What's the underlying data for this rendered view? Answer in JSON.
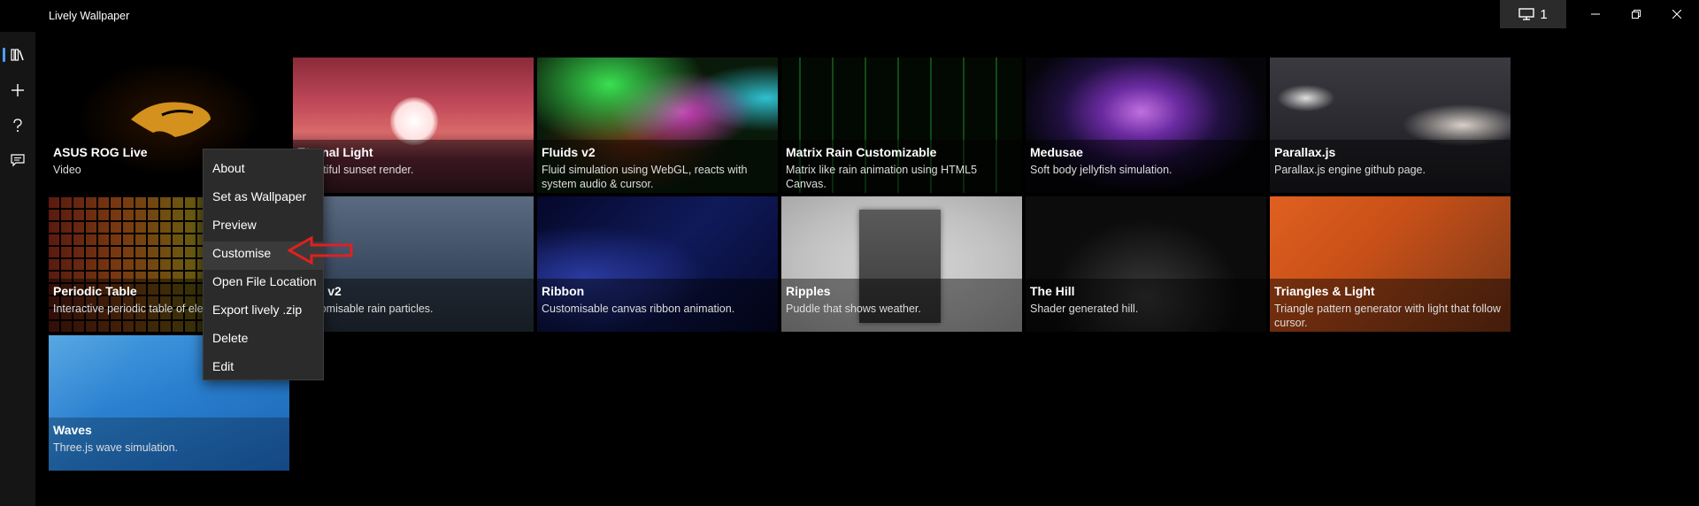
{
  "app": {
    "title": "Lively Wallpaper"
  },
  "titlebar": {
    "monitor_count": "1"
  },
  "nav": {
    "items": [
      {
        "icon": "library-icon",
        "label": "Library"
      },
      {
        "icon": "add-icon",
        "label": "Add"
      },
      {
        "icon": "help-icon",
        "label": "Help"
      },
      {
        "icon": "feedback-icon",
        "label": "Feedback"
      }
    ]
  },
  "tiles": [
    {
      "title": "ASUS ROG Live",
      "desc": "Video"
    },
    {
      "title": "Eternal Light",
      "desc": "Beautiful sunset render."
    },
    {
      "title": "Fluids v2",
      "desc": "Fluid simulation using WebGL, reacts with system audio & cursor."
    },
    {
      "title": "Matrix Rain Customizable",
      "desc": "Matrix like rain animation using HTML5 Canvas."
    },
    {
      "title": "Medusae",
      "desc": "Soft body jellyfish simulation."
    },
    {
      "title": "Parallax.js",
      "desc": "Parallax.js engine github page."
    },
    {
      "title": "Periodic Table",
      "desc": "Interactive periodic table of elements."
    },
    {
      "title": "Rain v2",
      "desc": "Customisable rain particles."
    },
    {
      "title": "Ribbon",
      "desc": "Customisable canvas ribbon animation."
    },
    {
      "title": "Ripples",
      "desc": "Puddle that shows weather."
    },
    {
      "title": "The Hill",
      "desc": "Shader generated hill."
    },
    {
      "title": "Triangles & Light",
      "desc": "Triangle pattern generator with light that follow cursor."
    },
    {
      "title": "Waves",
      "desc": "Three.js wave simulation."
    }
  ],
  "context_menu": {
    "items": [
      "About",
      "Set as Wallpaper",
      "Preview",
      "Customise",
      "Open File Location",
      "Export lively .zip",
      "Delete",
      "Edit"
    ],
    "highlighted": "Customise"
  },
  "colors": {
    "background": "#000000",
    "nav_background": "#151515",
    "selection_outline": "#3a7bd5",
    "menu_background": "#2b2b2b",
    "annotation_arrow": "#e02020"
  }
}
